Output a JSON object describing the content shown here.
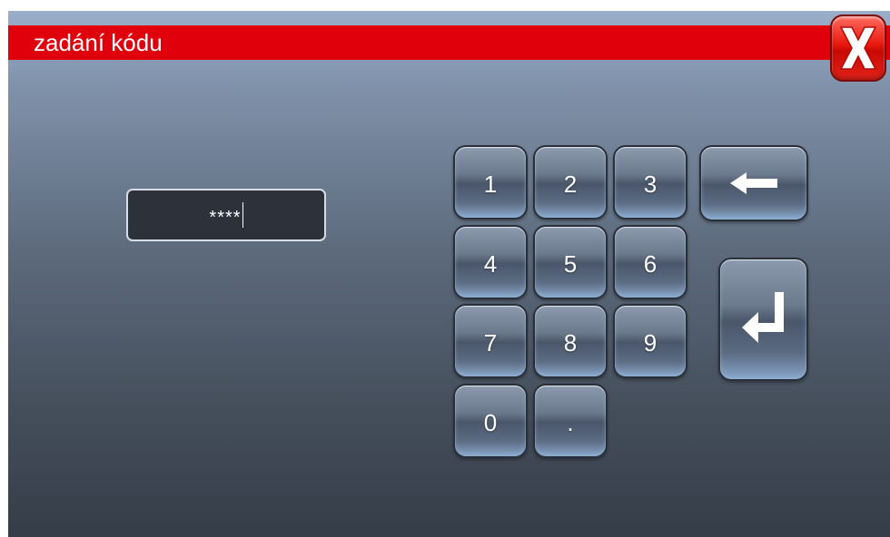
{
  "window": {
    "title": "zadání kódu",
    "colors": {
      "title_bar": "#e0000b",
      "close_button": "#e8180e"
    }
  },
  "close_button": {
    "icon": "close-x-icon"
  },
  "code_input": {
    "value": "****"
  },
  "keypad": {
    "keys": [
      "1",
      "2",
      "3",
      "4",
      "5",
      "6",
      "7",
      "8",
      "9",
      "0",
      "."
    ],
    "backspace_icon": "arrow-left-icon",
    "enter_icon": "enter-return-icon"
  }
}
